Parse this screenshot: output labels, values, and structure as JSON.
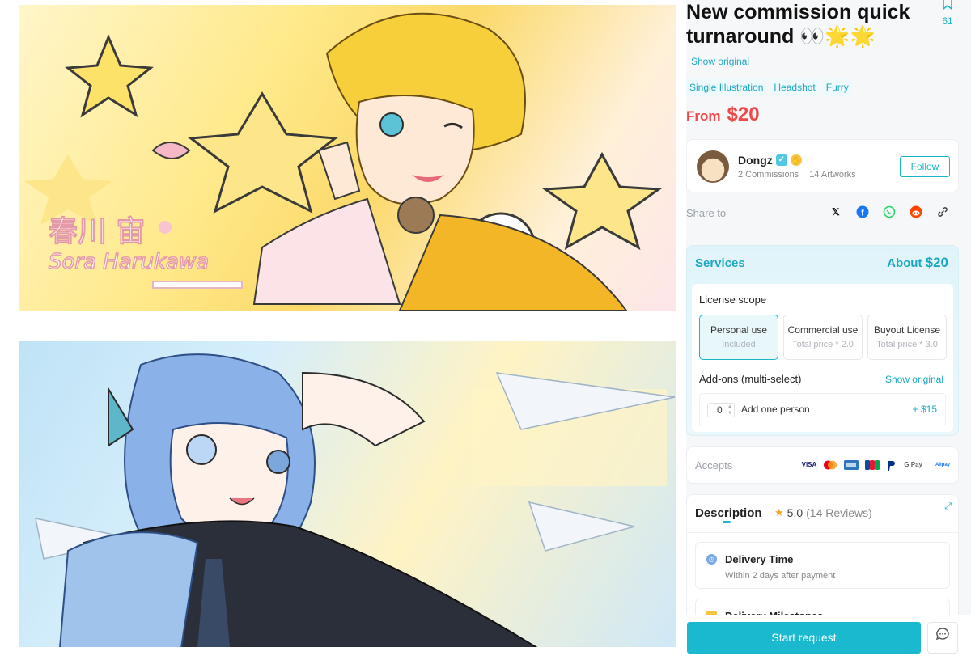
{
  "listing": {
    "title": "New commission quick turnaround",
    "title_emoji": "👀🌟🌟",
    "bookmark_count": "61",
    "show_original": "Show original",
    "tags": [
      "Single Illustration",
      "Headshot",
      "Furry"
    ],
    "price_prefix": "From",
    "price": "$20"
  },
  "artworks": [
    {
      "caption_top": "春川 宙",
      "caption_bottom": "Sora Harukawa"
    },
    {}
  ],
  "artist": {
    "name": "Dongz",
    "commissions": "2 Commissions",
    "artworks": "14 Artworks",
    "follow_label": "Follow"
  },
  "share": {
    "label": "Share to",
    "icons": [
      "x-icon",
      "facebook-icon",
      "whatsapp-icon",
      "reddit-icon",
      "link-icon"
    ]
  },
  "services": {
    "title": "Services",
    "about_prefix": "About",
    "about_price": "$20",
    "license_title": "License scope",
    "options": [
      {
        "label": "Personal use",
        "sub": "Included",
        "selected": true
      },
      {
        "label": "Commercial use",
        "sub": "Total price * 2.0",
        "selected": false
      },
      {
        "label": "Buyout License",
        "sub": "Total price * 3.0",
        "selected": false
      }
    ],
    "addons_title": "Add-ons (multi-select)",
    "addons_show_original": "Show original",
    "addon": {
      "quantity": "0",
      "label": "Add one person",
      "price": "+ $15"
    }
  },
  "accepts": {
    "label": "Accepts",
    "methods": [
      "VISA",
      "Mastercard",
      "AMEX",
      "JCB",
      "PayPal",
      "G Pay",
      "Pay",
      "Alipay"
    ]
  },
  "description": {
    "tab_label": "Description",
    "rating": "5.0",
    "reviews": "(14 Reviews)",
    "delivery_title": "Delivery Time",
    "delivery_sub": "Within 2 days after payment",
    "milestone_title": "Delivery Milestones"
  },
  "actions": {
    "start_request": "Start request"
  },
  "colors": {
    "accent": "#1ab9cf",
    "price": "#f04848"
  }
}
